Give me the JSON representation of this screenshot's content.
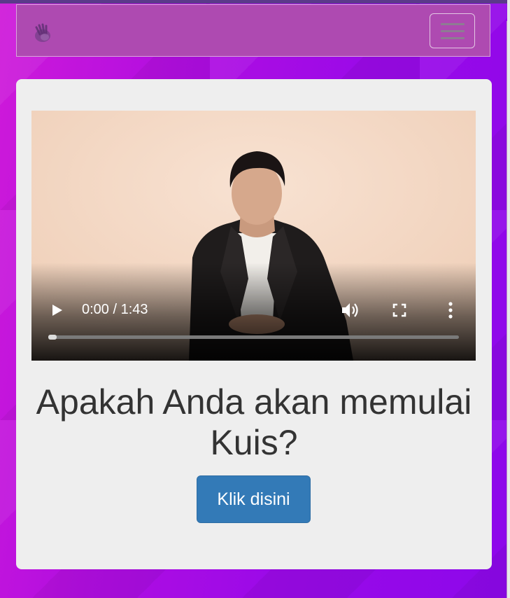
{
  "navbar": {
    "logo_icon": "hand-logo-icon",
    "toggle_icon": "hamburger-menu-icon"
  },
  "video": {
    "current_time": "0:00",
    "time_separator": " / ",
    "duration": "1:43",
    "progress": 0,
    "icons": [
      "play-icon",
      "volume-icon",
      "fullscreen-icon",
      "more-options-icon"
    ]
  },
  "quiz": {
    "question": "Apakah Anda akan memulai Kuis?",
    "button_label": "Klik disini"
  },
  "colors": {
    "navbar": "#ae4ab1",
    "button": "#337ab7",
    "background_start": "#cf1ad9",
    "background_end": "#8c07ea"
  }
}
